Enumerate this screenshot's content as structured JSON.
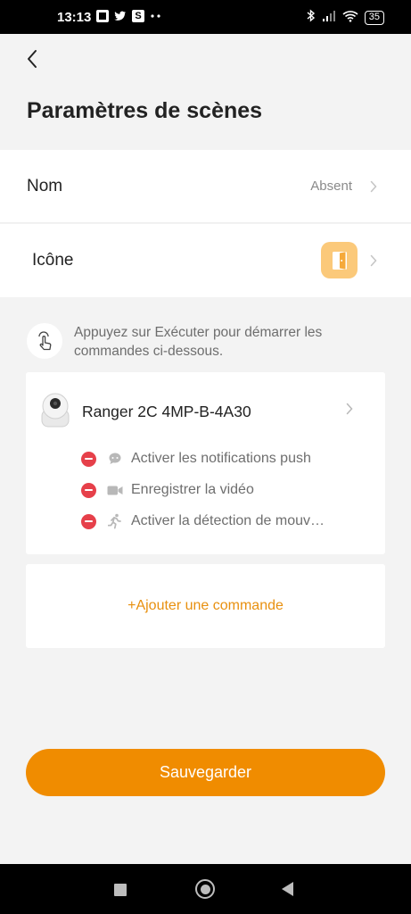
{
  "status_bar": {
    "time": "13:13",
    "left_icons": [
      "notification-icon",
      "twitter-icon",
      "s-app-icon",
      "more-dots-icon"
    ],
    "s_glyph": "S",
    "battery": "35"
  },
  "header": {
    "title": "Paramètres de scènes"
  },
  "settings": {
    "name_label": "Nom",
    "name_value": "Absent",
    "icon_label": "Icône",
    "icon_color": "#fbc97a"
  },
  "hint": {
    "text": "Appuyez sur Exécuter pour démarrer les commandes ci-dessous."
  },
  "device": {
    "name": "Ranger 2C 4MP-B-4A30",
    "actions": [
      {
        "icon": "chat-bubble-icon",
        "label": "Activer les notifications push"
      },
      {
        "icon": "video-camera-icon",
        "label": "Enregistrer la vidéo"
      },
      {
        "icon": "running-person-icon",
        "label": "Activer la détection de mouv…"
      }
    ]
  },
  "add_command": {
    "label": "+Ajouter une commande"
  },
  "save_button": {
    "label": "Sauvegarder"
  },
  "colors": {
    "accent": "#f08c00",
    "add_text": "#e8900f",
    "remove_red": "#e6404a",
    "background": "#f3f3f3"
  }
}
